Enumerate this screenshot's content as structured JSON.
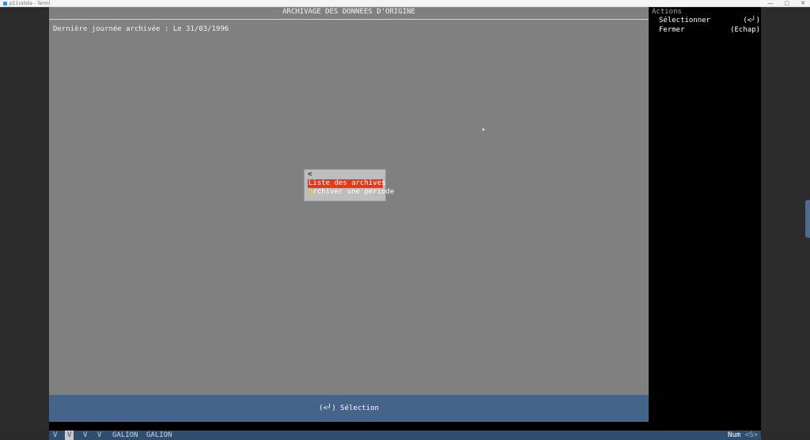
{
  "window": {
    "title": "p11ratela - Terml",
    "minimize": "—",
    "maximize": "▢",
    "close": "✕"
  },
  "screen": {
    "header": "ARCHIVAGE DES DONNEES D'ORIGINE",
    "last_archive": "Dernière journée archivée : Le 31/03/1996"
  },
  "menu": {
    "back": "<",
    "items": [
      {
        "hotkey": "L",
        "rest": "iste des archives",
        "selected": true
      },
      {
        "hotkey": "A",
        "rest": "rchiver une période",
        "selected": false
      }
    ]
  },
  "actions": {
    "title": "Actions",
    "rows": [
      {
        "label": "Sélectionner",
        "key": "(<┘)"
      },
      {
        "label": "Fermer",
        "key": "(Echap)"
      }
    ]
  },
  "status": {
    "text": "(<┘) Sélection"
  },
  "bottombar": {
    "segments": [
      "V",
      "V",
      "V",
      "V",
      "GALION",
      "GALION"
    ],
    "active_index": 1,
    "num_label": "Num",
    "num_key": "<S>"
  },
  "colors": {
    "main_bg": "#808080",
    "menu_selected": "#e33a1e",
    "hotkey": "#ffd800",
    "status_bar": "#44648a",
    "bottom_bar": "#2f4f72"
  },
  "icons": {
    "app": "terminal-app-icon",
    "pointer": "mouse-pointer-icon"
  }
}
